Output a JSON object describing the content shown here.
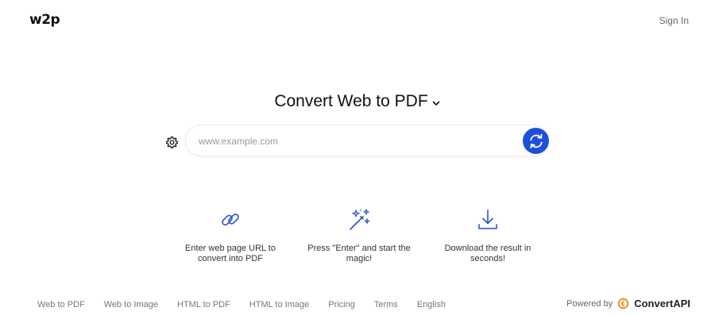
{
  "header": {
    "logo": "w2p",
    "sign_in": "Sign In"
  },
  "main": {
    "title": "Convert Web to PDF",
    "search": {
      "placeholder": "www.example.com",
      "value": ""
    }
  },
  "steps": [
    {
      "icon": "link-icon",
      "text": "Enter web page URL to convert into PDF"
    },
    {
      "icon": "magic-wand-icon",
      "text": "Press \"Enter\" and start the magic!"
    },
    {
      "icon": "download-icon",
      "text": "Download the result in seconds!"
    }
  ],
  "footer": {
    "links": [
      "Web to PDF",
      "Web to Image",
      "HTML to PDF",
      "HTML to Image",
      "Pricing",
      "Terms",
      "English"
    ],
    "powered_by": "Powered by",
    "brand": "ConvertAPI"
  },
  "colors": {
    "accent": "#1e4fdc",
    "icon_blue": "#2a55c9",
    "brand_orange": "#f08a1c"
  }
}
